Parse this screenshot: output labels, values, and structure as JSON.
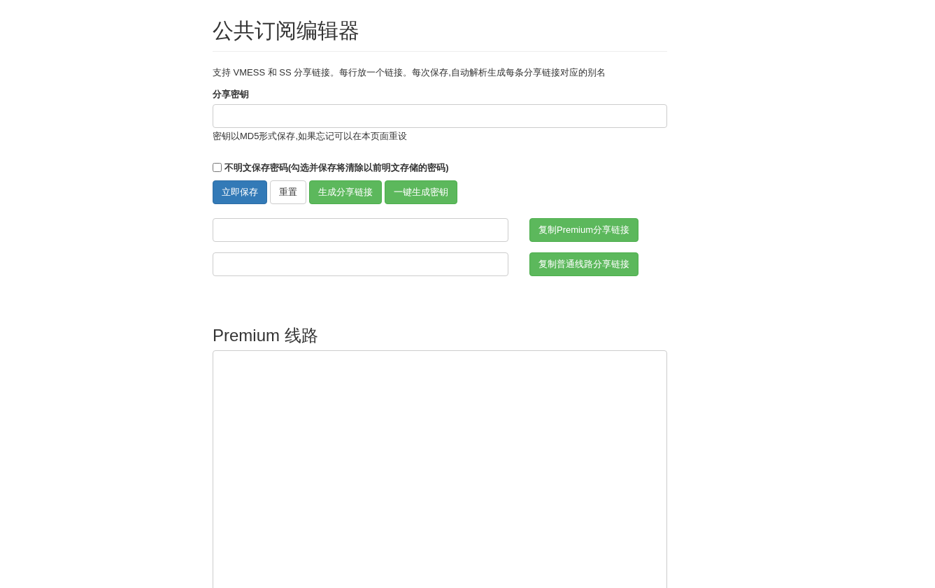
{
  "title": "公共订阅编辑器",
  "description": "支持 VMESS 和 SS 分享链接。每行放一个链接。每次保存,自动解析生成每条分享链接对应的别名",
  "key_field": {
    "label": "分享密钥",
    "help": "密钥以MD5形式保存,如果忘记可以在本页面重设"
  },
  "no_plaintext": {
    "label": "不明文保存密码(勾选并保存将清除以前明文存储的密码)",
    "checked": false
  },
  "buttons": [
    {
      "label": "立即保存",
      "kind": "primary"
    },
    {
      "label": "重置",
      "kind": "default"
    },
    {
      "label": "生成分享链接",
      "kind": "success"
    },
    {
      "label": "一键生成密钥",
      "kind": "success"
    }
  ],
  "share_links": [
    {
      "button": "复制Premium分享链接"
    },
    {
      "button": "复制普通线路分享链接"
    }
  ],
  "premium_section": {
    "heading": "Premium 线路"
  }
}
